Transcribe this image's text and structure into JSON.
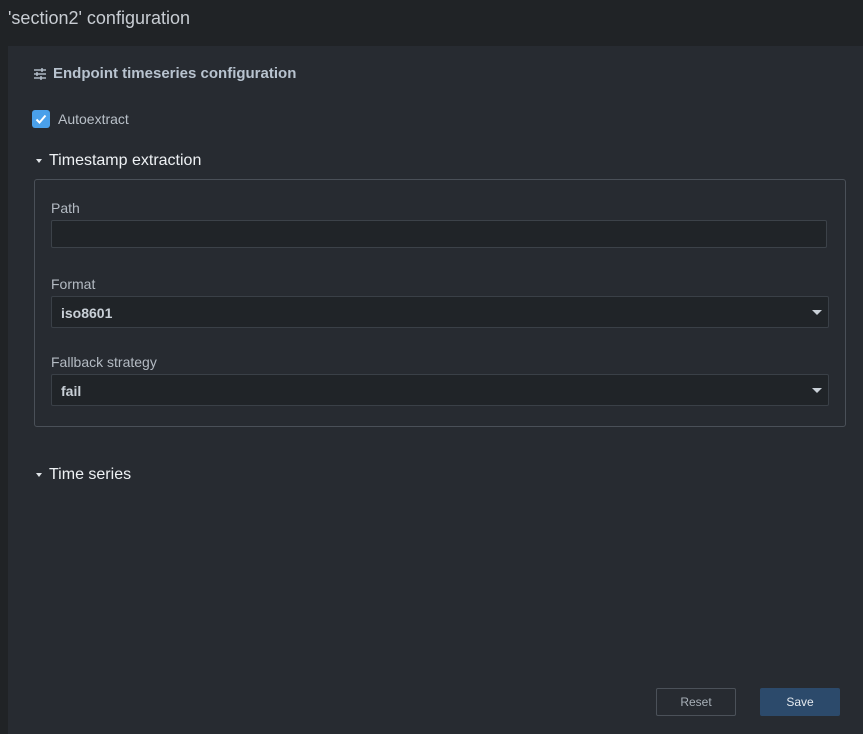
{
  "header": {
    "title": "'section2' configuration"
  },
  "section": {
    "title": "Endpoint timeseries configuration",
    "icon": "tune-icon"
  },
  "autoextract": {
    "label": "Autoextract",
    "checked": true
  },
  "timestamp_extraction": {
    "label": "Timestamp extraction",
    "expanded": true,
    "path": {
      "label": "Path",
      "value": "",
      "placeholder": ""
    },
    "format": {
      "label": "Format",
      "value": "iso8601"
    },
    "fallback": {
      "label": "Fallback strategy",
      "value": "fail"
    }
  },
  "time_series": {
    "label": "Time series",
    "expanded": true
  },
  "actions": {
    "reset_label": "Reset",
    "save_label": "Save"
  },
  "colors": {
    "accent": "#4aa0ea",
    "save_button": "#2c4a6b",
    "panel_bg": "#272b31",
    "page_bg": "#202326"
  }
}
